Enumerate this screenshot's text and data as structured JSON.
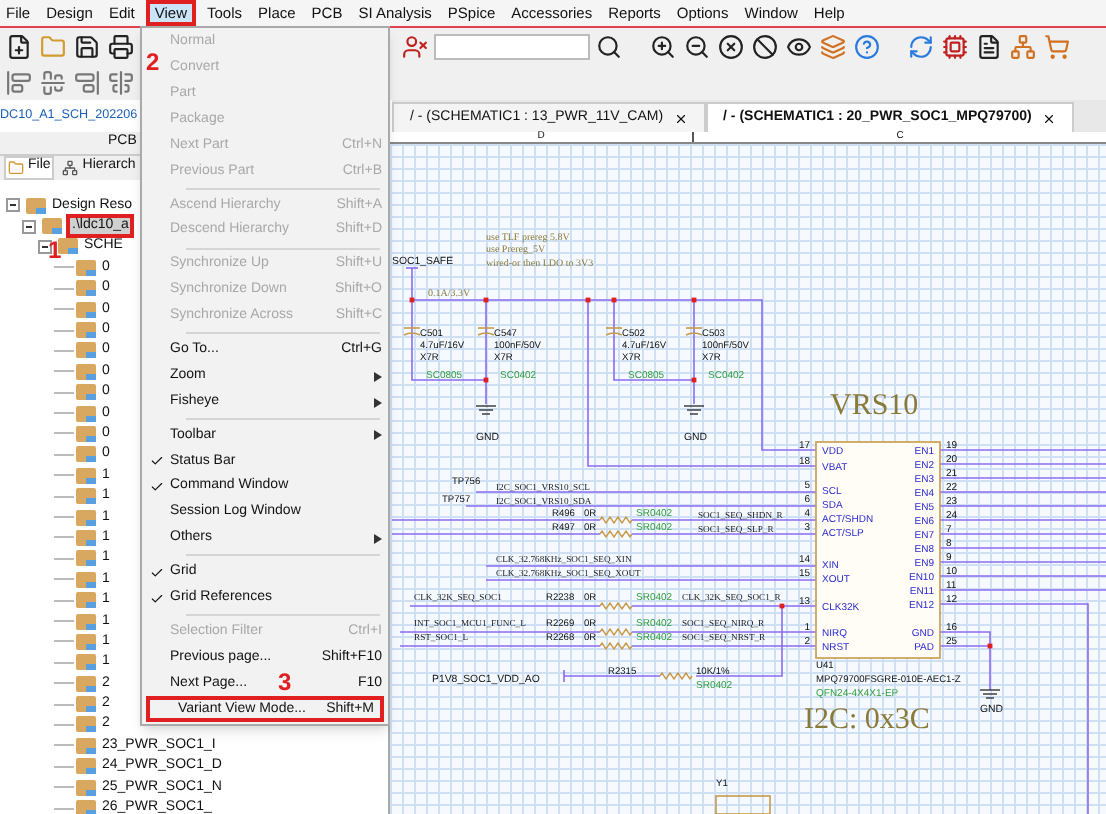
{
  "menubar": [
    {
      "label": "File",
      "selected": false,
      "annotated": false
    },
    {
      "label": "Design",
      "selected": false,
      "annotated": false
    },
    {
      "label": "Edit",
      "selected": false,
      "annotated": false
    },
    {
      "label": "View",
      "selected": true,
      "annotated": true
    },
    {
      "label": "Tools",
      "selected": false,
      "annotated": false
    },
    {
      "label": "Place",
      "selected": false,
      "annotated": false
    },
    {
      "label": "PCB",
      "selected": false,
      "annotated": false
    },
    {
      "label": "SI Analysis",
      "selected": false,
      "annotated": false
    },
    {
      "label": "PSpice",
      "selected": false,
      "annotated": false
    },
    {
      "label": "Accessories",
      "selected": false,
      "annotated": false
    },
    {
      "label": "Reports",
      "selected": false,
      "annotated": false
    },
    {
      "label": "Options",
      "selected": false,
      "annotated": false
    },
    {
      "label": "Window",
      "selected": false,
      "annotated": false
    },
    {
      "label": "Help",
      "selected": false,
      "annotated": false
    }
  ],
  "project_title": "DC10_A1_SCH_202206",
  "doc_tabs": [
    {
      "label": "/ - (SCHEMATIC1 : 13_PWR_11V_CAM)",
      "selected": false
    },
    {
      "label": "/ - (SCHEMATIC1 : 20_PWR_SOC1_MPQ79700)",
      "selected": true
    }
  ],
  "panel": {
    "header": "PCB",
    "tabs": [
      {
        "label": "File",
        "selected": true
      },
      {
        "label": "Hierarch",
        "selected": false
      }
    ],
    "tree": [
      {
        "label": "Design Reso",
        "selected": false,
        "annotated": false,
        "expanded": true,
        "children": [
          {
            "label": ".\\ldc10_a",
            "selected": true,
            "annotated": true,
            "expanded": true,
            "children": [
              {
                "label": "SCHE",
                "selected": false,
                "annotated": false,
                "expanded": true,
                "children": [
                  {
                    "label": "0",
                    "selected": false,
                    "annotated": false
                  },
                  {
                    "label": "0",
                    "selected": false,
                    "annotated": false
                  },
                  {
                    "label": "0",
                    "selected": false,
                    "annotated": false
                  },
                  {
                    "label": "0",
                    "selected": false,
                    "annotated": false
                  },
                  {
                    "label": "0",
                    "selected": false,
                    "annotated": false
                  },
                  {
                    "label": "0",
                    "selected": false,
                    "annotated": false
                  },
                  {
                    "label": "0",
                    "selected": false,
                    "annotated": false
                  },
                  {
                    "label": "0",
                    "selected": false,
                    "annotated": false
                  },
                  {
                    "label": "0",
                    "selected": false,
                    "annotated": false
                  },
                  {
                    "label": "0",
                    "selected": false,
                    "annotated": false
                  },
                  {
                    "label": "1",
                    "selected": false,
                    "annotated": false
                  },
                  {
                    "label": "1",
                    "selected": false,
                    "annotated": false
                  },
                  {
                    "label": "1",
                    "selected": false,
                    "annotated": false
                  },
                  {
                    "label": "1",
                    "selected": false,
                    "annotated": false
                  },
                  {
                    "label": "1",
                    "selected": false,
                    "annotated": false
                  },
                  {
                    "label": "1",
                    "selected": false,
                    "annotated": false
                  },
                  {
                    "label": "1",
                    "selected": false,
                    "annotated": false
                  },
                  {
                    "label": "1",
                    "selected": false,
                    "annotated": false
                  },
                  {
                    "label": "1",
                    "selected": false,
                    "annotated": false
                  },
                  {
                    "label": "1",
                    "selected": false,
                    "annotated": false
                  },
                  {
                    "label": "2",
                    "selected": false,
                    "annotated": false
                  },
                  {
                    "label": "2",
                    "selected": false,
                    "annotated": false
                  },
                  {
                    "label": "2",
                    "selected": false,
                    "annotated": false
                  },
                  {
                    "label": "23_PWR_SOC1_I",
                    "selected": false,
                    "annotated": false
                  },
                  {
                    "label": "24_PWR_SOC1_D",
                    "selected": false,
                    "annotated": false
                  },
                  {
                    "label": "25_PWR_SOC1_N",
                    "selected": false,
                    "annotated": false
                  },
                  {
                    "label": "26_PWR_SOC1_",
                    "selected": false,
                    "annotated": false
                  }
                ]
              }
            ]
          }
        ]
      }
    ]
  },
  "view_menu": [
    {
      "kind": "item",
      "label": "Normal",
      "disabled": true,
      "checked": false,
      "annotated": false
    },
    {
      "kind": "item",
      "label": "Convert",
      "disabled": true,
      "checked": false,
      "annotated": false
    },
    {
      "kind": "item",
      "label": "Part",
      "disabled": true,
      "checked": false,
      "annotated": false
    },
    {
      "kind": "item",
      "label": "Package",
      "disabled": true,
      "checked": false,
      "annotated": false
    },
    {
      "kind": "item",
      "label": "Next Part",
      "shortcut": "Ctrl+N",
      "disabled": true,
      "checked": false,
      "annotated": false
    },
    {
      "kind": "item",
      "label": "Previous Part",
      "shortcut": "Ctrl+B",
      "disabled": true,
      "checked": false,
      "annotated": false
    },
    {
      "kind": "separator"
    },
    {
      "kind": "item",
      "label": "Ascend Hierarchy",
      "shortcut": "Shift+A",
      "disabled": true,
      "checked": false,
      "annotated": false
    },
    {
      "kind": "item",
      "label": "Descend Hierarchy",
      "shortcut": "Shift+D",
      "disabled": true,
      "checked": false,
      "annotated": false
    },
    {
      "kind": "separator"
    },
    {
      "kind": "item",
      "label": "Synchronize Up",
      "shortcut": "Shift+U",
      "disabled": true,
      "checked": false,
      "annotated": false
    },
    {
      "kind": "item",
      "label": "Synchronize Down",
      "shortcut": "Shift+O",
      "disabled": true,
      "checked": false,
      "annotated": false
    },
    {
      "kind": "item",
      "label": "Synchronize Across",
      "shortcut": "Shift+C",
      "disabled": true,
      "checked": false,
      "annotated": false
    },
    {
      "kind": "separator"
    },
    {
      "kind": "item",
      "label": "Go To...",
      "shortcut": "Ctrl+G",
      "disabled": false,
      "checked": false,
      "annotated": false
    },
    {
      "kind": "submenu",
      "label": "Zoom",
      "disabled": false,
      "checked": false,
      "annotated": false
    },
    {
      "kind": "submenu",
      "label": "Fisheye",
      "disabled": false,
      "checked": false,
      "annotated": false
    },
    {
      "kind": "separator"
    },
    {
      "kind": "submenu",
      "label": "Toolbar",
      "disabled": false,
      "checked": false,
      "annotated": false
    },
    {
      "kind": "item",
      "label": "Status Bar",
      "disabled": false,
      "checked": true,
      "annotated": false
    },
    {
      "kind": "item",
      "label": "Command Window",
      "disabled": false,
      "checked": true,
      "annotated": false
    },
    {
      "kind": "item",
      "label": "Session Log Window",
      "disabled": false,
      "checked": false,
      "annotated": false
    },
    {
      "kind": "submenu",
      "label": "Others",
      "disabled": false,
      "checked": false,
      "annotated": false
    },
    {
      "kind": "separator"
    },
    {
      "kind": "item",
      "label": "Grid",
      "disabled": false,
      "checked": true,
      "annotated": false
    },
    {
      "kind": "item",
      "label": "Grid References",
      "disabled": false,
      "checked": true,
      "annotated": false
    },
    {
      "kind": "separator"
    },
    {
      "kind": "item",
      "label": "Selection Filter",
      "shortcut": "Ctrl+I",
      "disabled": true,
      "checked": false,
      "annotated": false
    },
    {
      "kind": "item",
      "label": "Previous page...",
      "shortcut": "Shift+F10",
      "disabled": false,
      "checked": false,
      "annotated": false
    },
    {
      "kind": "item",
      "label": "Next Page...",
      "shortcut": "F10",
      "disabled": false,
      "checked": false,
      "annotated": false
    },
    {
      "kind": "item",
      "label": "Variant View Mode...",
      "shortcut": "Shift+M",
      "disabled": false,
      "checked": false,
      "annotated": true
    }
  ],
  "annotations": [
    {
      "text": "1"
    },
    {
      "text": "2"
    },
    {
      "text": "3"
    }
  ],
  "schematic": {
    "columns": [
      "D",
      "C"
    ],
    "labels": [
      {
        "text": "use TLF prereg 5.8V",
        "kind": "note"
      },
      {
        "text": "use Prereg_5V",
        "kind": "note"
      },
      {
        "text": "SOC1_SAFE",
        "kind": "net"
      },
      {
        "text": "wired-or then LDO to 3V3",
        "kind": "note"
      },
      {
        "text": "0.1A/3.3V",
        "kind": "note"
      },
      {
        "text": "C501",
        "kind": "part"
      },
      {
        "text": "4.7uF/16V",
        "kind": "part"
      },
      {
        "text": "X7R",
        "kind": "part"
      },
      {
        "text": "SC0805",
        "kind": "footprint"
      },
      {
        "text": "C547",
        "kind": "part"
      },
      {
        "text": "100nF/50V",
        "kind": "part"
      },
      {
        "text": "X7R",
        "kind": "part"
      },
      {
        "text": "SC0402",
        "kind": "footprint"
      },
      {
        "text": "C502",
        "kind": "part"
      },
      {
        "text": "4.7uF/16V",
        "kind": "part"
      },
      {
        "text": "X7R",
        "kind": "part"
      },
      {
        "text": "SC0805",
        "kind": "footprint"
      },
      {
        "text": "C503",
        "kind": "part"
      },
      {
        "text": "100nF/50V",
        "kind": "part"
      },
      {
        "text": "X7R",
        "kind": "part"
      },
      {
        "text": "SC0402",
        "kind": "footprint"
      },
      {
        "text": "GND",
        "kind": "net"
      },
      {
        "text": "GND",
        "kind": "net"
      },
      {
        "text": "VRS10",
        "kind": "title"
      },
      {
        "text": "TP756",
        "kind": "part"
      },
      {
        "text": "TP757",
        "kind": "part"
      },
      {
        "text": "I2C_SOC1_VRS10_SCL",
        "kind": "signal"
      },
      {
        "text": "I2C_SOC1_VRS10_SDA",
        "kind": "signal"
      },
      {
        "text": "R496",
        "kind": "part"
      },
      {
        "text": "0R",
        "kind": "part"
      },
      {
        "text": "SR0402",
        "kind": "footprint"
      },
      {
        "text": "SOC1_SEQ_SHDN_R",
        "kind": "signal"
      },
      {
        "text": "R497",
        "kind": "part"
      },
      {
        "text": "0R",
        "kind": "part"
      },
      {
        "text": "SR0402",
        "kind": "footprint"
      },
      {
        "text": "SOC1_SEQ_SLP_R",
        "kind": "signal"
      },
      {
        "text": "CLK_32.768KHz_SOC1_SEQ_XIN",
        "kind": "signal"
      },
      {
        "text": "CLK_32.768KHz_SOC1_SEQ_XOUT",
        "kind": "signal"
      },
      {
        "text": "CLK_32K_SEQ_SOC1",
        "kind": "signal"
      },
      {
        "text": "R2238",
        "kind": "part"
      },
      {
        "text": "0R",
        "kind": "part"
      },
      {
        "text": "SR0402",
        "kind": "footprint"
      },
      {
        "text": "CLK_32K_SEQ_SOC1_R",
        "kind": "signal"
      },
      {
        "text": "INT_SOC1_MCU1_FUNC_L",
        "kind": "signal"
      },
      {
        "text": "R2269",
        "kind": "part"
      },
      {
        "text": "0R",
        "kind": "part"
      },
      {
        "text": "SR0402",
        "kind": "footprint"
      },
      {
        "text": "SOC1_SEQ_NIRQ_R",
        "kind": "signal"
      },
      {
        "text": "RST_SOC1_L",
        "kind": "signal"
      },
      {
        "text": "R2268",
        "kind": "part"
      },
      {
        "text": "0R",
        "kind": "part"
      },
      {
        "text": "SR0402",
        "kind": "footprint"
      },
      {
        "text": "SOC1_SEQ_NRST_R",
        "kind": "signal"
      },
      {
        "text": "P1V8_SOC1_VDD_AO",
        "kind": "net"
      },
      {
        "text": "R2315",
        "kind": "part"
      },
      {
        "text": "10K/1%",
        "kind": "part"
      },
      {
        "text": "SR0402",
        "kind": "footprint"
      },
      {
        "text": "GND",
        "kind": "net"
      },
      {
        "text": "U41",
        "kind": "part"
      },
      {
        "text": "MPQ79700FSGRE-010E-AEC1-Z",
        "kind": "part"
      },
      {
        "text": "QFN24-4X4X1-EP",
        "kind": "footprint"
      },
      {
        "text": "I2C: 0x3C",
        "kind": "title"
      },
      {
        "text": "Y1",
        "kind": "part"
      }
    ],
    "left_pins": [
      {
        "number": "17",
        "name": "VDD"
      },
      {
        "number": "18",
        "name": "VBAT"
      },
      {
        "number": "5",
        "name": "SCL"
      },
      {
        "number": "6",
        "name": "SDA"
      },
      {
        "number": "4",
        "name": "ACT/SHDN"
      },
      {
        "number": "3",
        "name": "ACT/SLP"
      },
      {
        "number": "14",
        "name": "XIN"
      },
      {
        "number": "15",
        "name": "XOUT"
      },
      {
        "number": "13",
        "name": "CLK32K"
      },
      {
        "number": "1",
        "name": "NIRQ"
      },
      {
        "number": "2",
        "name": "NRST"
      }
    ],
    "right_pins": [
      {
        "number": "19",
        "name": "EN1"
      },
      {
        "number": "20",
        "name": "EN2"
      },
      {
        "number": "21",
        "name": "EN3"
      },
      {
        "number": "22",
        "name": "EN4"
      },
      {
        "number": "23",
        "name": "EN5"
      },
      {
        "number": "24",
        "name": "EN6"
      },
      {
        "number": "7",
        "name": "EN7"
      },
      {
        "number": "8",
        "name": "EN8"
      },
      {
        "number": "9",
        "name": "EN9"
      },
      {
        "number": "10",
        "name": "EN10"
      },
      {
        "number": "11",
        "name": "EN11"
      },
      {
        "number": "12",
        "name": "EN12"
      },
      {
        "number": "16",
        "name": "GND"
      },
      {
        "number": "25",
        "name": "PAD"
      }
    ]
  }
}
